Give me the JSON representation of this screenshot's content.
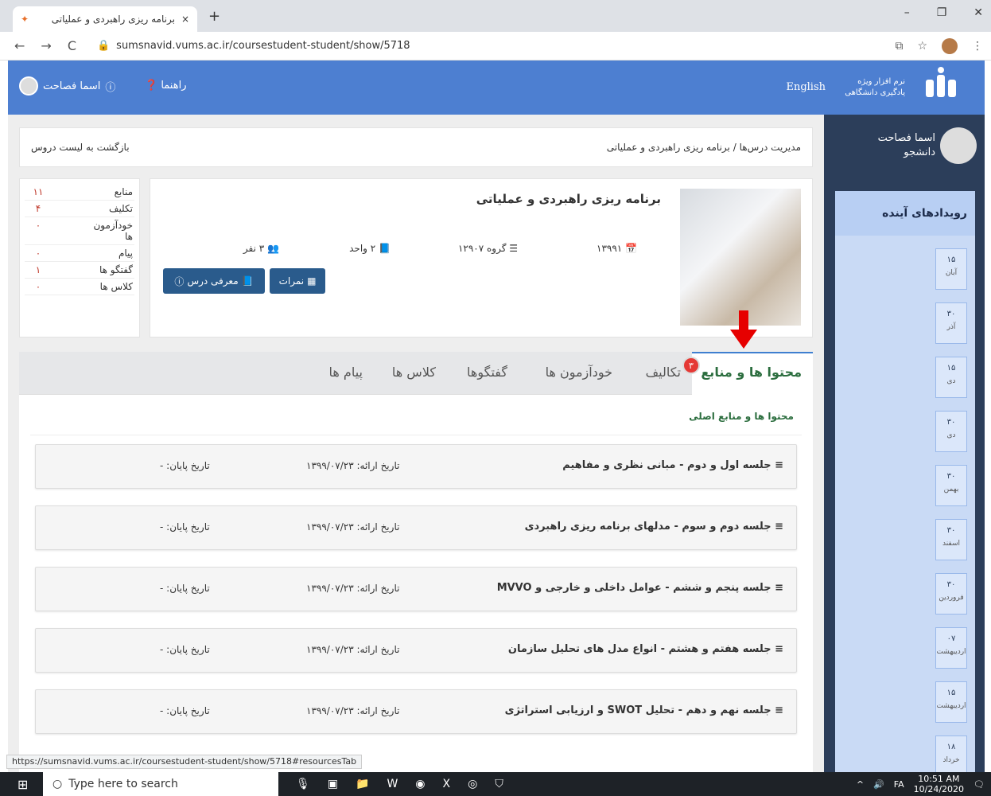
{
  "browser": {
    "tab_title": "برنامه ریزی راهبردی و عملیاتی",
    "tab_close": "×",
    "new_tab": "+",
    "url": "sumsnavid.vums.ac.ir/coursestudent-student/show/5718",
    "status_url": "https://sumsnavid.vums.ac.ir/coursestudent-student/show/5718#resourcesTab"
  },
  "header": {
    "brand_line1": "نرم افزار ویژه",
    "brand_line2": "یادگیری دانشگاهی",
    "language": "English",
    "guide": "راهنما",
    "user": "اسما فصاحت"
  },
  "sidebar": {
    "user_name": "اسما فصاحت",
    "user_role": "دانشجو",
    "events_title": "رویدادهای آینده",
    "events": [
      {
        "day": "۱۵",
        "month": "آبان"
      },
      {
        "day": "۳۰",
        "month": "آذر"
      },
      {
        "day": "۱۵",
        "month": "دی"
      },
      {
        "day": "۳۰",
        "month": "دی"
      },
      {
        "day": "۳۰",
        "month": "بهمن"
      },
      {
        "day": "۳۰",
        "month": "اسفند"
      },
      {
        "day": "۳۰",
        "month": "فروردین"
      },
      {
        "day": "۰۷",
        "month": "اردیبهشت"
      },
      {
        "day": "۱۵",
        "month": "اردیبهشت"
      },
      {
        "day": "۱۸",
        "month": "خرداد"
      }
    ]
  },
  "breadcrumb": {
    "root": "مدیریت درس‌ها",
    "sep": "/",
    "current": "برنامه ریزی راهبردی و عملیاتی",
    "back": "بازگشت به لیست دروس"
  },
  "stats": [
    {
      "label": "منابع",
      "value": "۱۱"
    },
    {
      "label": "تکلیف",
      "value": "۴"
    },
    {
      "label": "خودآزمون ها",
      "value": "۰"
    },
    {
      "label": "پیام",
      "value": "۰"
    },
    {
      "label": "گفتگو ها",
      "value": "۱"
    },
    {
      "label": "کلاس ها",
      "value": "۰"
    }
  ],
  "course": {
    "title": "برنامه ریزی راهبردی و عملیاتی",
    "year": "۱۳۹۹۱",
    "group": "گروه ۱۲۹۰۷",
    "units": "۲ واحد",
    "members": "۳ نفر",
    "grades_button": "نمرات",
    "intro_button": "معرفی درس"
  },
  "tabs": {
    "content": "محتوا ها و منابع",
    "assignments": "تکالیف",
    "assignments_badge": "۳",
    "quizzes": "خودآزمون ها",
    "discussions": "گفتگوها",
    "classes": "کلاس ها",
    "messages": "پیام ها"
  },
  "content": {
    "section_title": "محتوا ها و منابع اصلی",
    "items": [
      {
        "title": "جلسه اول و دوم - مبانی نظری و مفاهیم",
        "start": "تاریخ ارائه: ۱۳۹۹/۰۷/۲۳",
        "end": "تاریخ پایان: -"
      },
      {
        "title": "جلسه دوم و سوم - مدلهای برنامه ریزی راهبردی",
        "start": "تاریخ ارائه: ۱۳۹۹/۰۷/۲۳",
        "end": "تاریخ پایان: -"
      },
      {
        "title": "جلسه پنجم و ششم - عوامل داخلی و خارجی و MVVO",
        "start": "تاریخ ارائه: ۱۳۹۹/۰۷/۲۳",
        "end": "تاریخ پایان: -"
      },
      {
        "title": "جلسه هفتم و هشتم - انواع مدل های تحلیل سازمان",
        "start": "تاریخ ارائه: ۱۳۹۹/۰۷/۲۳",
        "end": "تاریخ پایان: -"
      },
      {
        "title": "جلسه نهم و دهم - تحلیل SWOT و ارزیابی استراتژی",
        "start": "تاریخ ارائه: ۱۳۹۹/۰۷/۲۳",
        "end": "تاریخ پایان: -"
      }
    ]
  },
  "taskbar": {
    "search_placeholder": "Type here to search",
    "lang": "FA",
    "time": "10:51 AM",
    "date": "10/24/2020"
  },
  "colors": {
    "header": "#4d7fd1",
    "sidebar": "#2c3e5a",
    "accent_green": "#2c6e3f",
    "badge": "#e53935"
  }
}
